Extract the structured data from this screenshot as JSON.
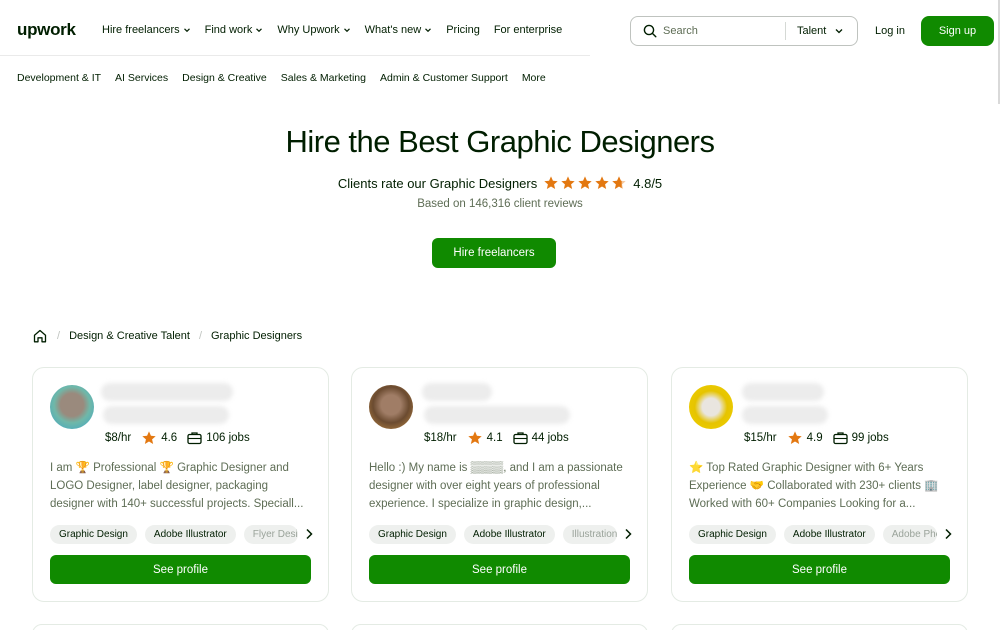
{
  "header": {
    "logo": "upwork",
    "menu": [
      {
        "label": "Hire freelancers",
        "dropdown": true
      },
      {
        "label": "Find work",
        "dropdown": true
      },
      {
        "label": "Why Upwork",
        "dropdown": true
      },
      {
        "label": "What's new",
        "dropdown": true
      },
      {
        "label": "Pricing",
        "dropdown": false
      },
      {
        "label": "For enterprise",
        "dropdown": false
      }
    ],
    "search_placeholder": "Search",
    "search_scope": "Talent",
    "login_label": "Log in",
    "signup_label": "Sign up"
  },
  "categories": [
    "Development & IT",
    "AI Services",
    "Design & Creative",
    "Sales & Marketing",
    "Admin & Customer Support",
    "More"
  ],
  "hero": {
    "title": "Hire the Best Graphic Designers",
    "rating_prefix": "Clients rate our Graphic Designers",
    "rating_score": "4.8/5",
    "rating_value": 4.8,
    "reviews": "Based on 146,316 client reviews",
    "cta": "Hire freelancers"
  },
  "breadcrumb": {
    "items": [
      "Design & Creative Talent",
      "Graphic Designers"
    ]
  },
  "cards": [
    {
      "rate": "$8/hr",
      "score": "4.6",
      "jobs": "106 jobs",
      "description": "I am 🏆 Professional 🏆 Graphic Designer and LOGO Designer, label designer, packaging designer with 140+ successful projects. Speciall...",
      "skills": [
        "Graphic Design",
        "Adobe Illustrator",
        "Flyer Design"
      ],
      "cta": "See profile"
    },
    {
      "rate": "$18/hr",
      "score": "4.1",
      "jobs": "44 jobs",
      "description": "Hello :) My name is ▒▒▒▒, and I am a passionate designer with over eight years of professional experience. I specialize in graphic design,...",
      "skills": [
        "Graphic Design",
        "Adobe Illustrator",
        "Illustration"
      ],
      "cta": "See profile"
    },
    {
      "rate": "$15/hr",
      "score": "4.9",
      "jobs": "99 jobs",
      "description": "⭐ Top Rated Graphic Designer with 6+ Years Experience 🤝 Collaborated with 230+ clients 🏢 Worked with 60+ Companies Looking for a...",
      "skills": [
        "Graphic Design",
        "Adobe Illustrator",
        "Adobe Photoshop"
      ],
      "cta": "See profile"
    }
  ],
  "colors": {
    "brand_green": "#108a00",
    "star_orange": "#e37811",
    "text_dark": "#001e00",
    "text_muted": "#5e6d55"
  }
}
